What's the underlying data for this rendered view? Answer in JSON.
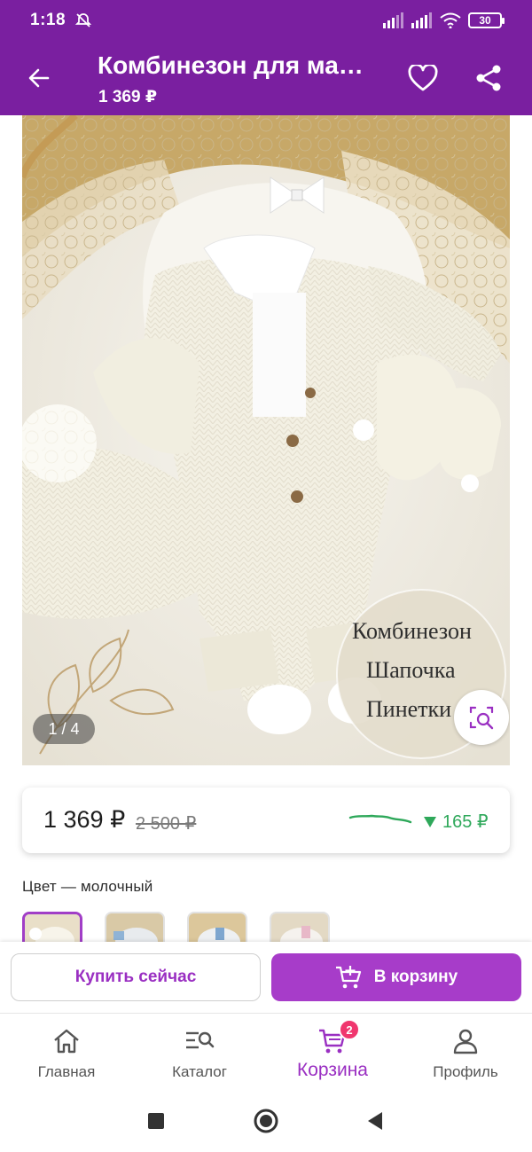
{
  "status_bar": {
    "time": "1:18",
    "battery": "30",
    "icons": [
      "dnd-off-icon",
      "signal-icon",
      "signal-icon",
      "wifi-icon",
      "battery-icon"
    ]
  },
  "app_bar": {
    "title": "Комбинезон для ма…",
    "price": "1 369 ₽",
    "icons": [
      "arrow-back-icon",
      "heart-icon",
      "share-icon"
    ]
  },
  "gallery": {
    "counter": "1 / 4",
    "caption_lines": [
      "Комбинезон",
      "Шапочка",
      "Пинетки"
    ],
    "icons": [
      "visual-search-icon"
    ]
  },
  "price_card": {
    "current": "1 369 ₽",
    "old": "2 500 ₽",
    "drop": "165 ₽",
    "icons": [
      "price-history-chart-icon",
      "triangle-down-icon"
    ]
  },
  "color": {
    "label": "Цвет — молочный",
    "swatch_count": 4,
    "selected_index": 0
  },
  "actions": {
    "buy_now": "Купить сейчас",
    "add_to_cart": "В корзину",
    "icons": [
      "cart-plus-icon"
    ]
  },
  "bottom_nav": {
    "items": [
      {
        "label": "Главная",
        "icon": "home-icon"
      },
      {
        "label": "Каталог",
        "icon": "catalog-search-icon"
      },
      {
        "label": "Корзина",
        "icon": "cart-icon",
        "badge": "2",
        "active": true
      },
      {
        "label": "Профиль",
        "icon": "profile-icon"
      }
    ]
  },
  "colors": {
    "primary": "#7a1fa0",
    "accent": "#a73cc9",
    "price_drop": "#2ea85a",
    "badge": "#f0366e"
  }
}
